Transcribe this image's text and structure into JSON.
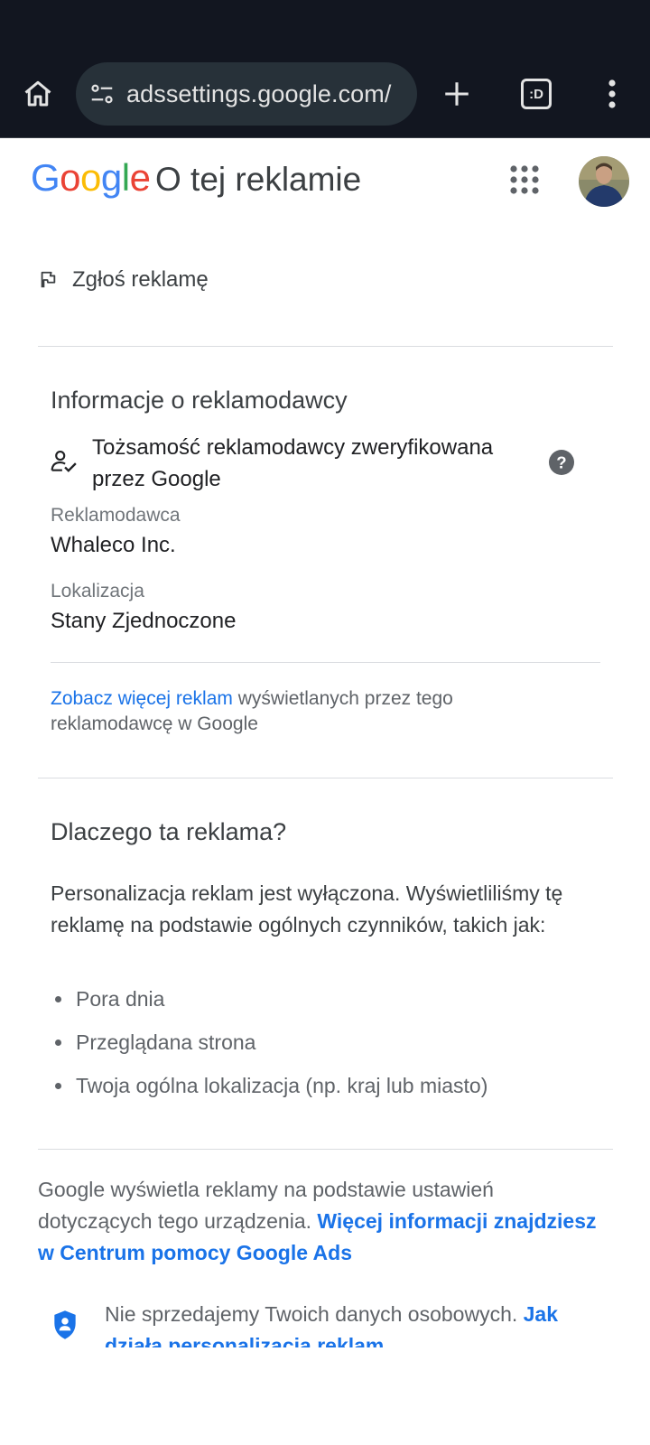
{
  "browser": {
    "url": "adssettings.google.com/",
    "icons": [
      "home-icon",
      "site-settings-icon",
      "new-tab-icon",
      "tab-switcher-icon",
      "overflow-menu-icon"
    ],
    "tab_switcher_label": ":D"
  },
  "header": {
    "logo_letters": [
      "G",
      "o",
      "o",
      "g",
      "l",
      "e"
    ],
    "logo_colors": [
      "#4285F4",
      "#EA4335",
      "#FBBC05",
      "#4285F4",
      "#34A853",
      "#EA4335"
    ],
    "title": "O tej reklamie"
  },
  "report": {
    "label": "Zgłoś reklamę"
  },
  "advertiser": {
    "heading": "Informacje o reklamodawcy",
    "verified_text": "Tożsamość reklamodawcy zweryfikowana przez Google",
    "advertiser_label": "Reklamodawca",
    "advertiser_value": "Whaleco Inc.",
    "location_label": "Lokalizacja",
    "location_value": "Stany Zjednoczone",
    "more_ads_link": "Zobacz więcej reklam",
    "more_ads_rest": " wyświetlanych przez tego reklamodawcę w Google"
  },
  "why": {
    "heading": "Dlaczego ta reklama?",
    "text": "Personalizacja reklam jest wyłączona. Wyświetliliśmy tę reklamę na podstawie ogólnych czynników, takich jak:",
    "reasons": [
      "Pora dnia",
      "Przeglądana strona",
      "Twoja ogólna lokalizacja (np. kraj lub miasto)"
    ]
  },
  "footer": {
    "text": "Google wyświetla reklamy na podstawie ustawień dotyczących tego urządzenia. ",
    "link": "Więcej informacji znajdziesz w Centrum pomocy Google Ads",
    "privacy_text": "Nie sprzedajemy Twoich danych osobowych. ",
    "privacy_link": "Jak działa personalizacja reklam"
  },
  "colors": {
    "link": "#1a73e8",
    "browser_bar": "#121620",
    "omnibox": "#273139"
  }
}
